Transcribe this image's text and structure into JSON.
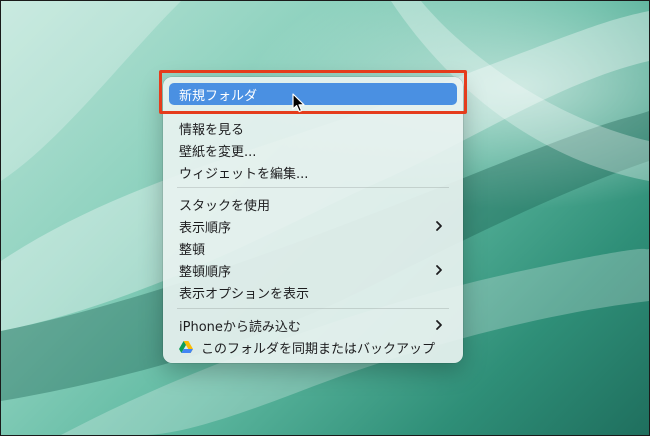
{
  "menu": {
    "items": [
      {
        "label": "新規フォルダ"
      },
      {
        "label": "情報を見る"
      },
      {
        "label": "壁紙を変更..."
      },
      {
        "label": "ウィジェットを編集..."
      },
      {
        "label": "スタックを使用"
      },
      {
        "label": "表示順序"
      },
      {
        "label": "整頓"
      },
      {
        "label": "整頓順序"
      },
      {
        "label": "表示オプションを表示"
      },
      {
        "label": "iPhoneから読み込む"
      },
      {
        "label": "このフォルダを同期またはバックアップ"
      }
    ]
  },
  "colors": {
    "highlight": "#4a90e2",
    "annotation_border": "#e53c1c"
  },
  "icons": {
    "drive": "google-drive-icon",
    "chevron": "chevron-right-icon",
    "cursor": "mouse-pointer-icon"
  }
}
